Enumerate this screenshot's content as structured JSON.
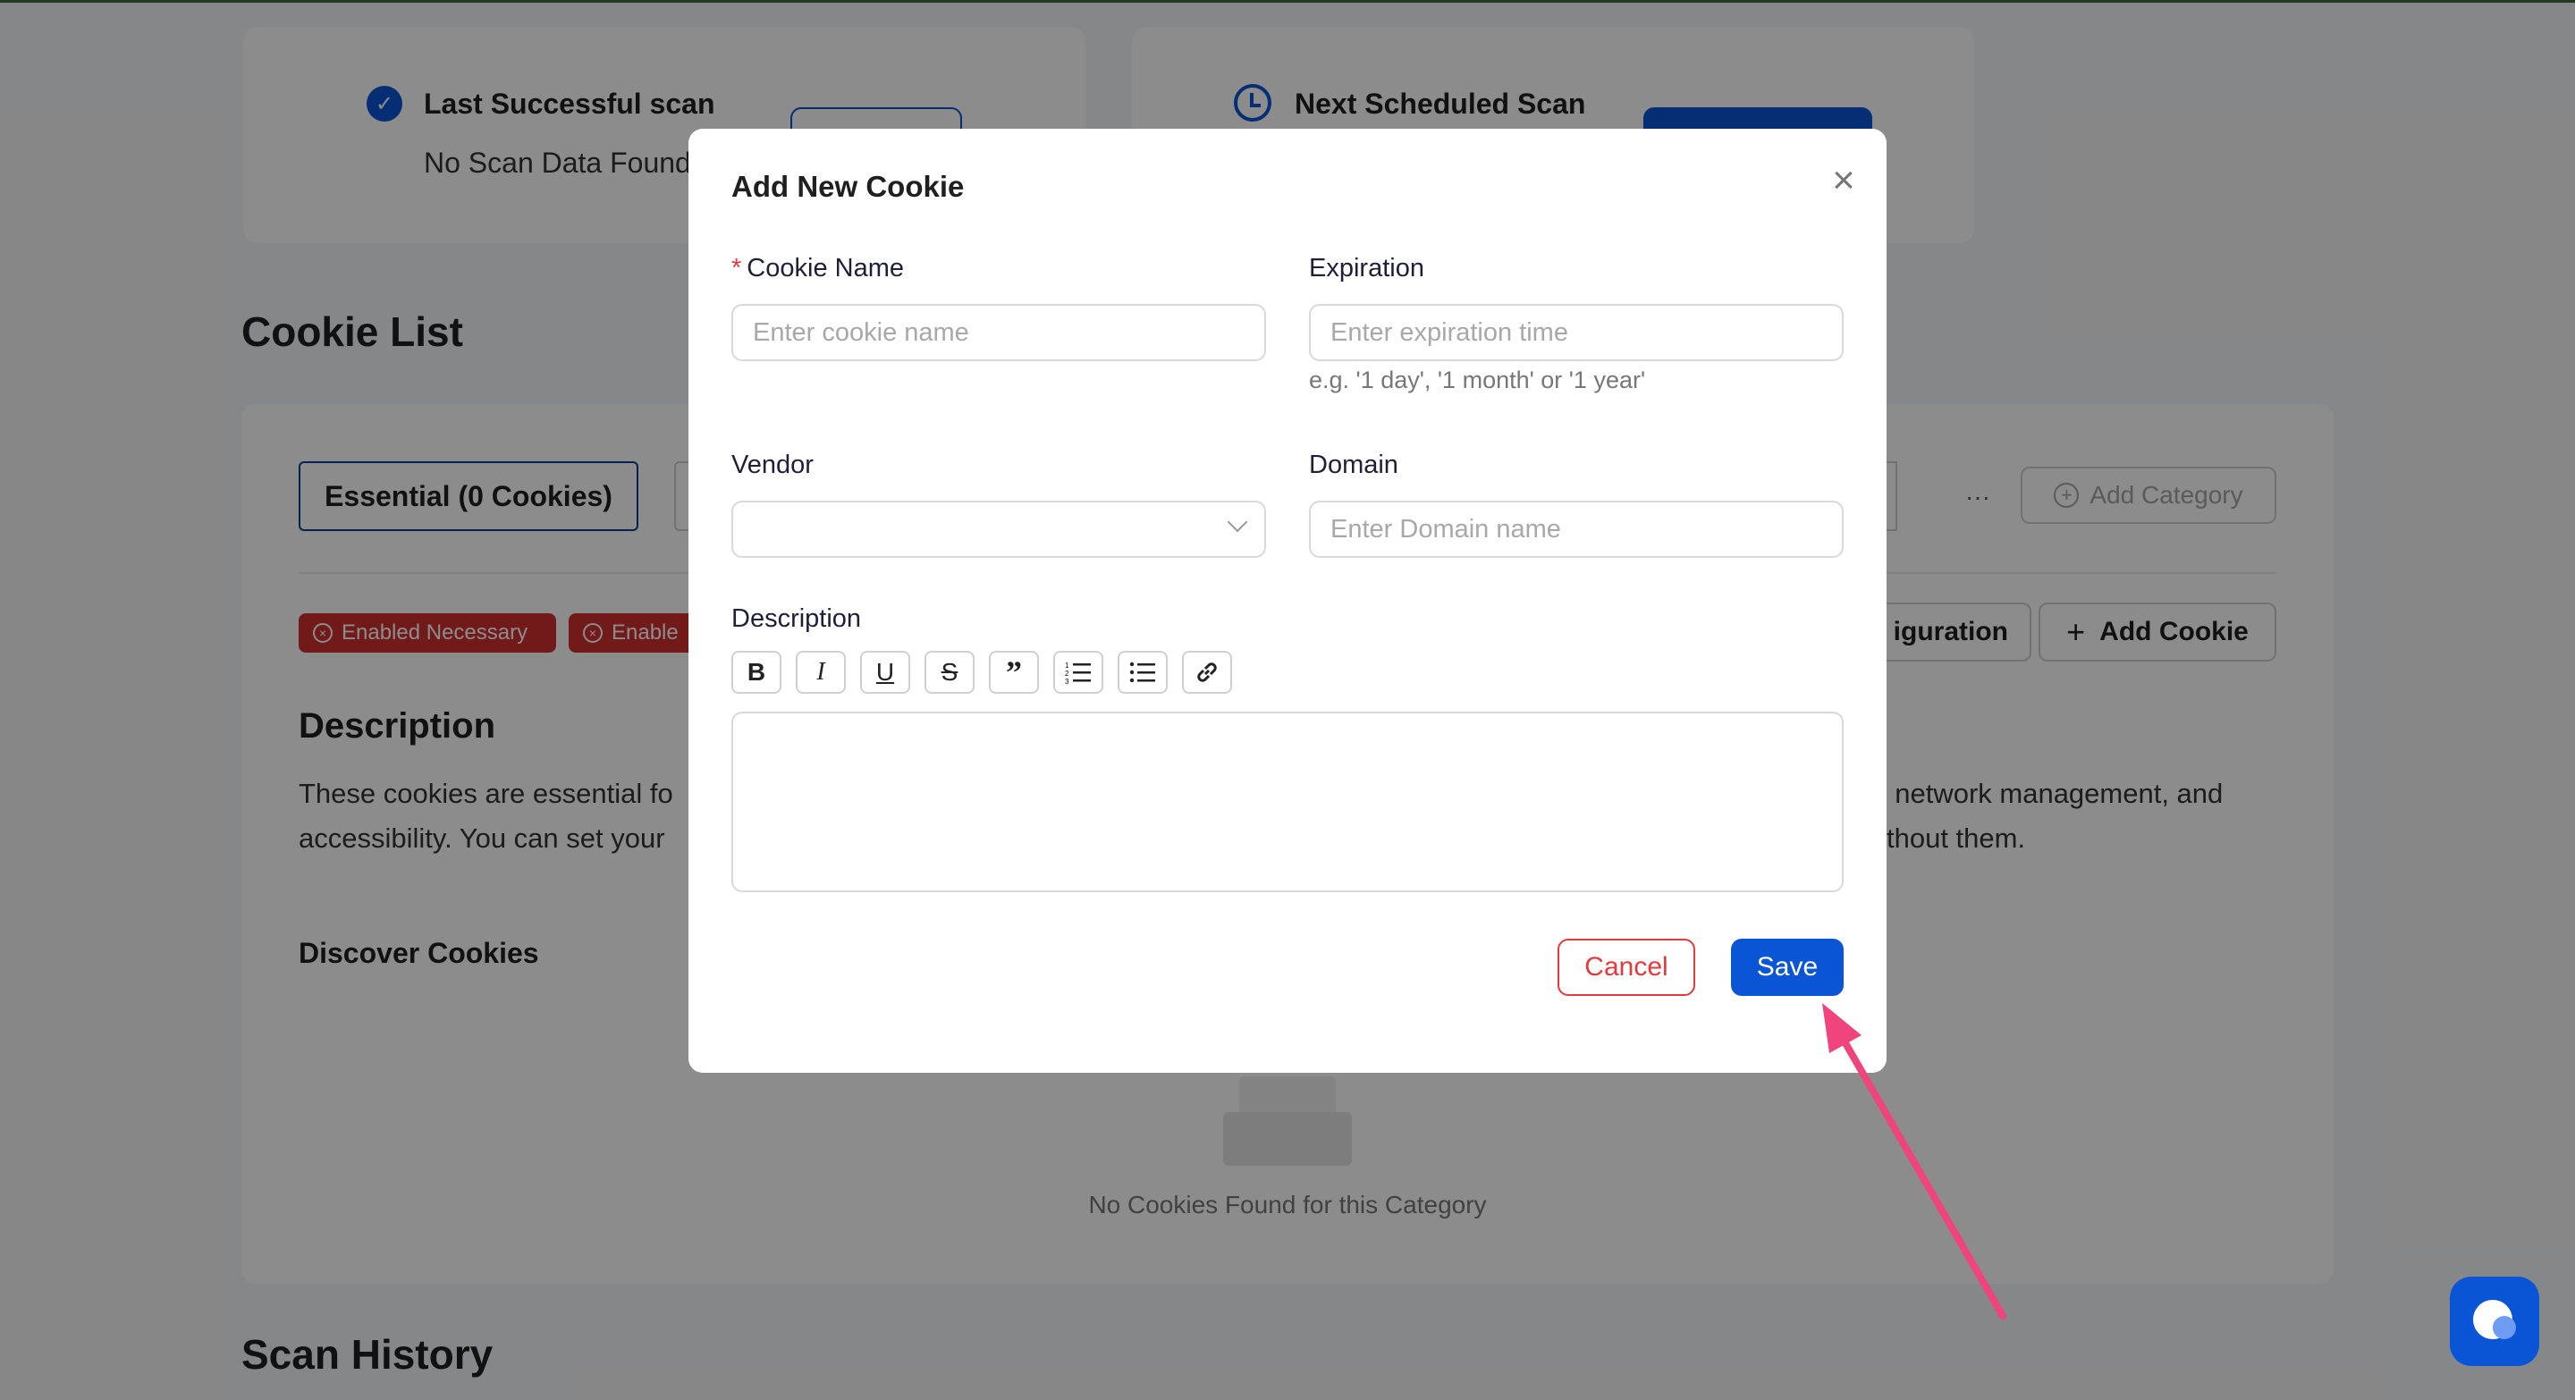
{
  "scan": {
    "last_title": "Last Successful scan",
    "last_status": "No Scan Data Found",
    "next_title": "Next Scheduled Scan"
  },
  "cookie_list": {
    "title": "Cookie List",
    "active_tab": "Essential (0 Cookies)",
    "add_category": "Add Category",
    "more": "···",
    "tags": [
      "Enabled Necessary",
      "Enable"
    ],
    "configuration_btn": "iguration",
    "add_cookie_btn": "Add Cookie",
    "description_heading": "Description",
    "description_line1_left": "These cookies are essential fo",
    "description_line1_right": ", network management, and",
    "description_line2_left": "accessibility. You can set your",
    "description_line2_right": "thout them.",
    "discover_heading": "Discover Cookies",
    "empty_text": "No Cookies Found for this Category"
  },
  "scan_history": {
    "title": "Scan History"
  },
  "modal": {
    "title": "Add New Cookie",
    "required_mark": "*",
    "cookie_name_label": "Cookie Name",
    "cookie_name_placeholder": "Enter cookie name",
    "expiration_label": "Expiration",
    "expiration_placeholder": "Enter expiration time",
    "expiration_hint": "e.g. '1 day', '1 month' or '1 year'",
    "vendor_label": "Vendor",
    "vendor_value": "",
    "domain_label": "Domain",
    "domain_placeholder": "Enter Domain name",
    "description_label": "Description",
    "description_value": "",
    "cancel_label": "Cancel",
    "save_label": "Save"
  },
  "colors": {
    "primary": "#0a55d6",
    "danger": "#e5393b",
    "annotation_arrow": "#f0447c"
  }
}
